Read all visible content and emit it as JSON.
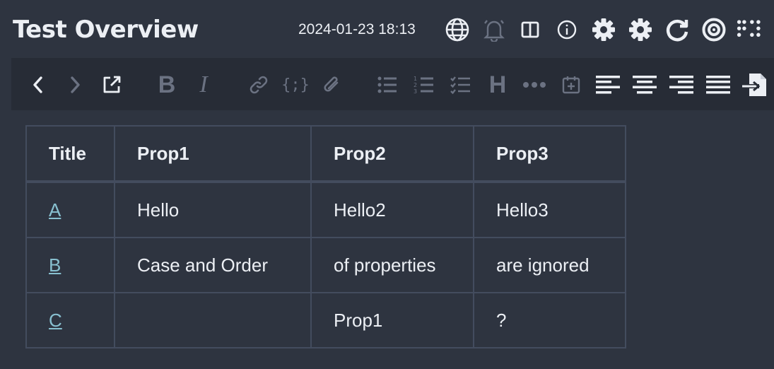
{
  "header": {
    "title": "Test Overview",
    "timestamp": "2024-01-23 18:13",
    "icons": [
      "globe-icon",
      "bell-icon",
      "split-view-icon",
      "info-icon",
      "gear-icon",
      "gear-icon",
      "refresh-icon",
      "target-icon",
      "braille-dots-icon"
    ]
  },
  "toolbar": {
    "bold": "B",
    "italic": "I",
    "heading": "H",
    "code": "{;}",
    "dots": "•••"
  },
  "table": {
    "headers": [
      "Title",
      "Prop1",
      "Prop2",
      "Prop3"
    ],
    "rows": [
      {
        "title": "A",
        "prop1": "Hello",
        "prop2": "Hello2",
        "prop3": "Hello3"
      },
      {
        "title": "B",
        "prop1": "Case and Order",
        "prop2": "of properties",
        "prop3": "are ignored"
      },
      {
        "title": "C",
        "prop1": "",
        "prop2": "Prop1",
        "prop3": "?"
      }
    ]
  },
  "colors": {
    "background": "#2e3440",
    "toolbar": "#272c36",
    "link": "#88c0d0",
    "text": "#eceff4",
    "icon_muted": "#6b7282"
  }
}
